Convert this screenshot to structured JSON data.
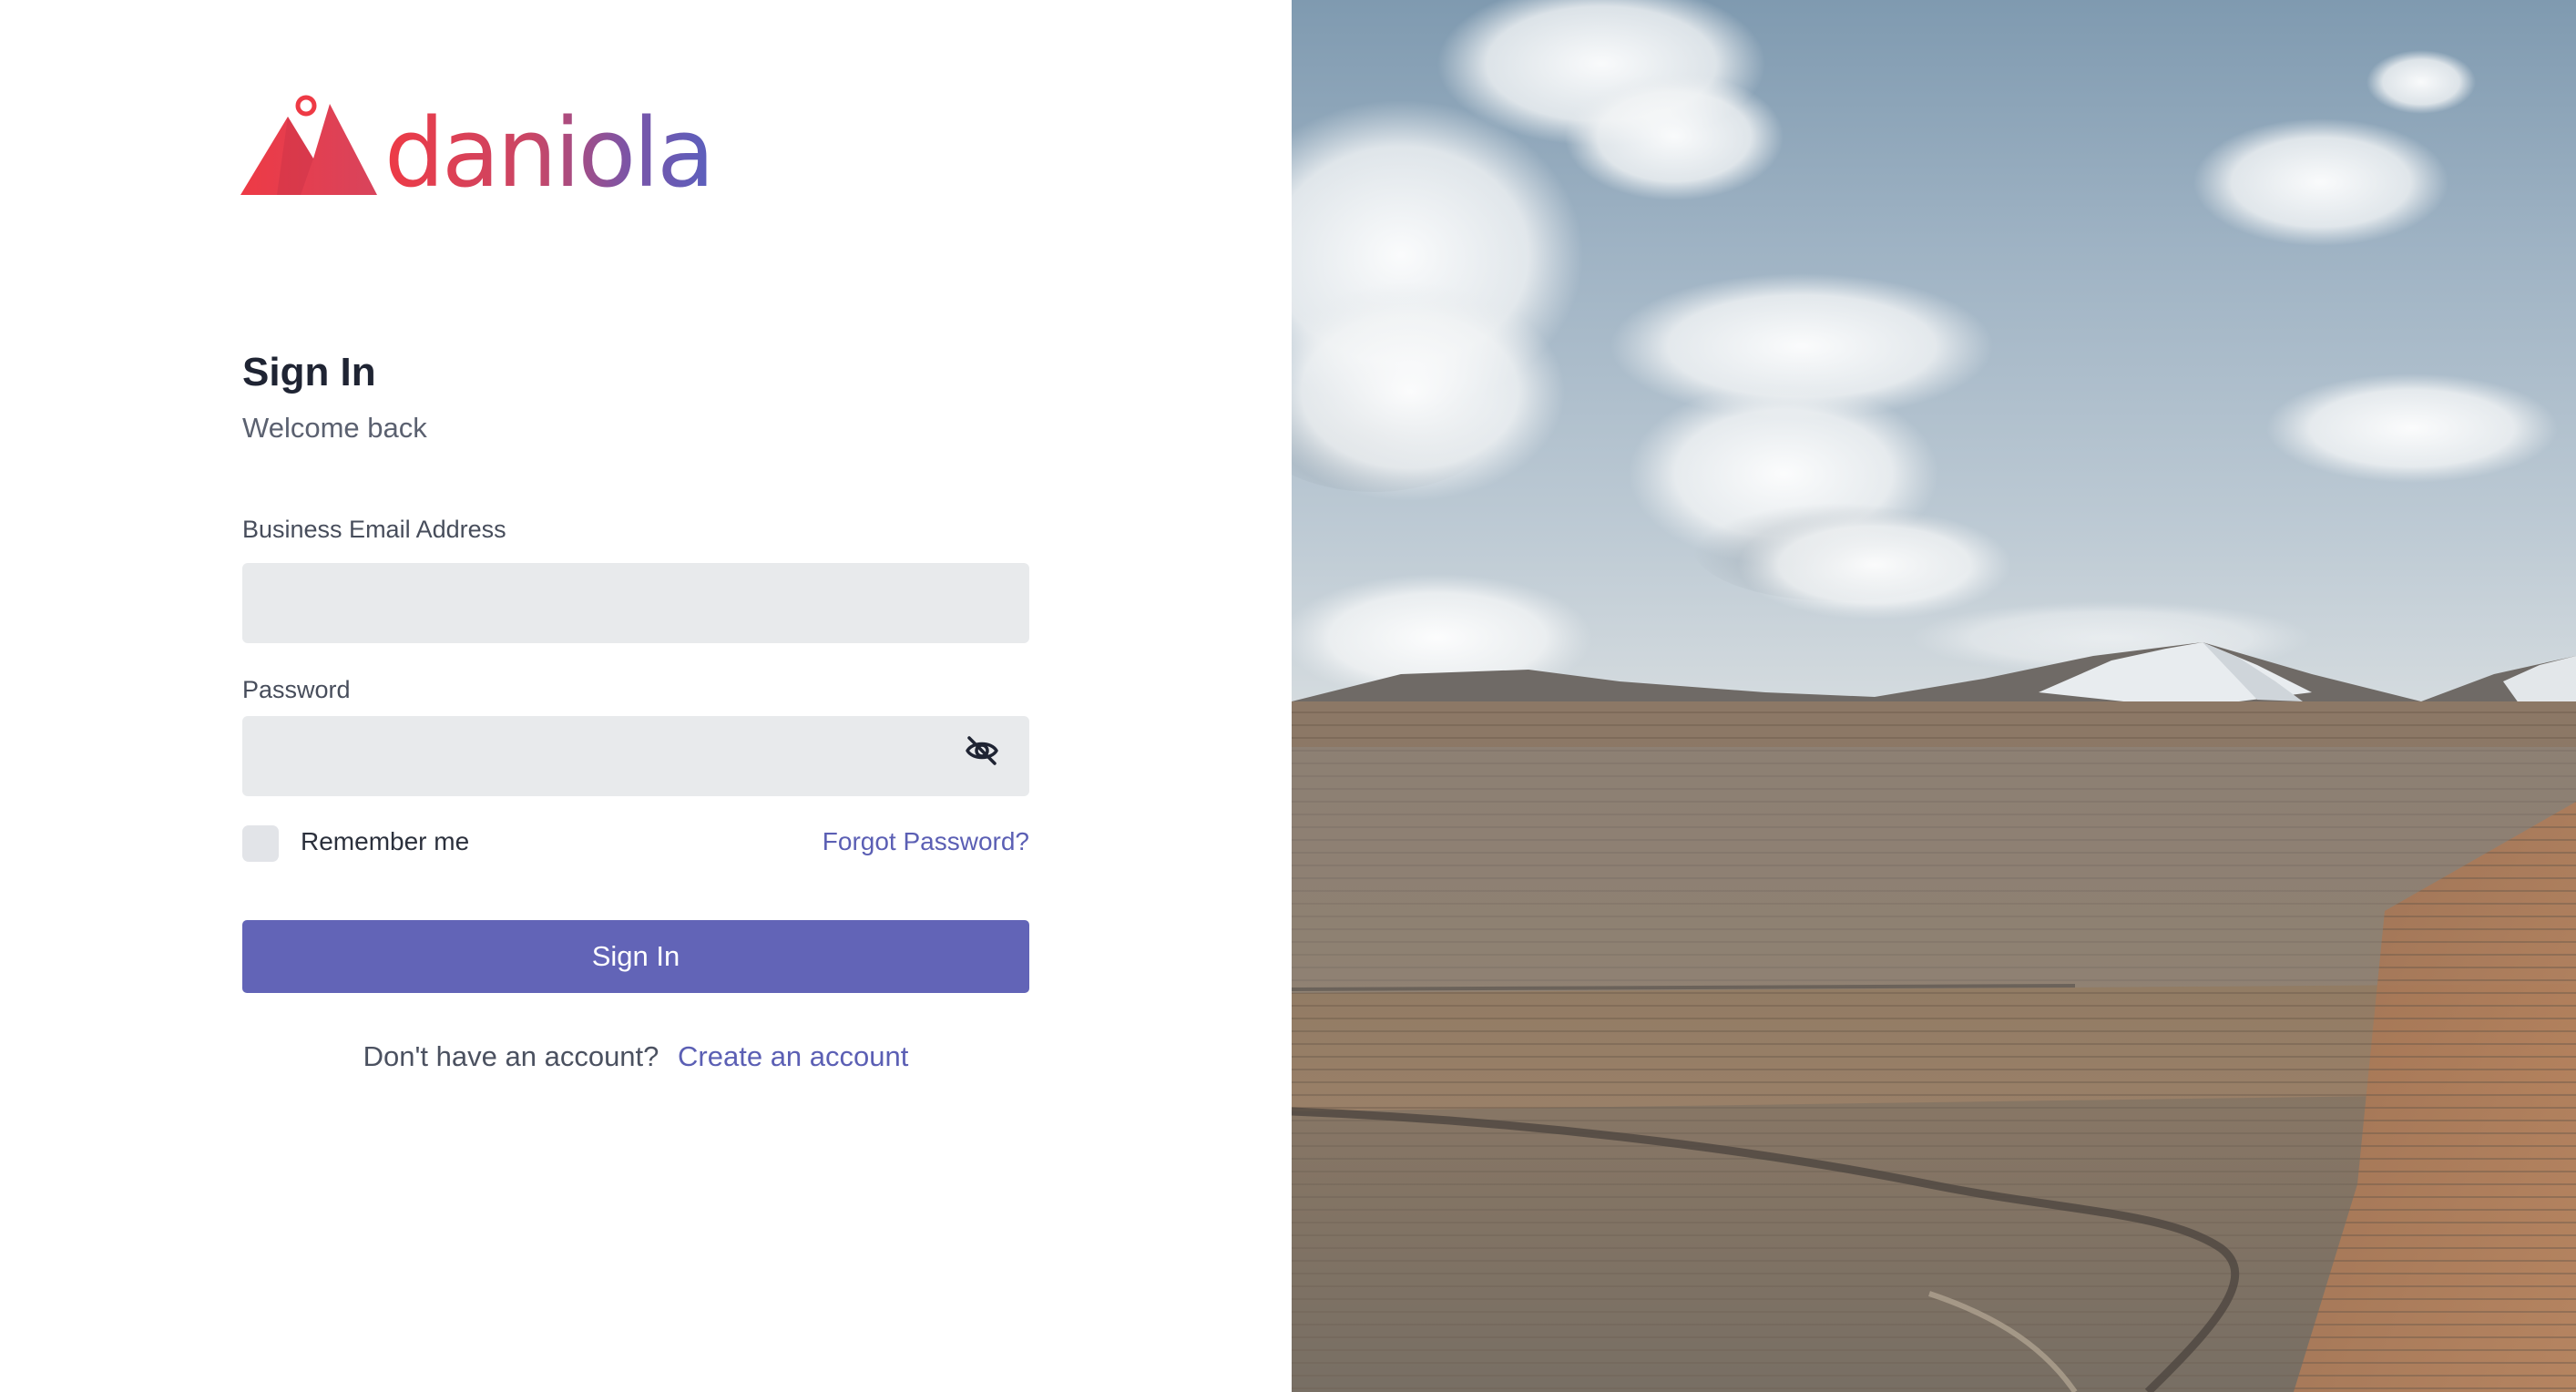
{
  "brand": {
    "name": "daniola",
    "logo_icon": "mountain-pin-icon"
  },
  "signin": {
    "title": "Sign In",
    "subtitle": "Welcome back"
  },
  "form": {
    "email": {
      "label": "Business Email Address",
      "value": "",
      "placeholder": ""
    },
    "password": {
      "label": "Password",
      "value": "",
      "placeholder": "",
      "toggle_icon": "eye-slash-icon"
    },
    "remember_me": {
      "label": "Remember me",
      "checked": false
    },
    "forgot_password": "Forgot Password?",
    "submit_label": "Sign In"
  },
  "footer": {
    "prompt": "Don't have an account?",
    "create_account": "Create an account"
  },
  "hero_image": {
    "subject": "open-pit mine under a cloudy sky"
  },
  "colors": {
    "primary": "#6264b7",
    "link": "#5b5fb4",
    "brand_red": "#ee3a45",
    "brand_purple": "#5b5fbd",
    "input_bg": "#e8eaec"
  }
}
